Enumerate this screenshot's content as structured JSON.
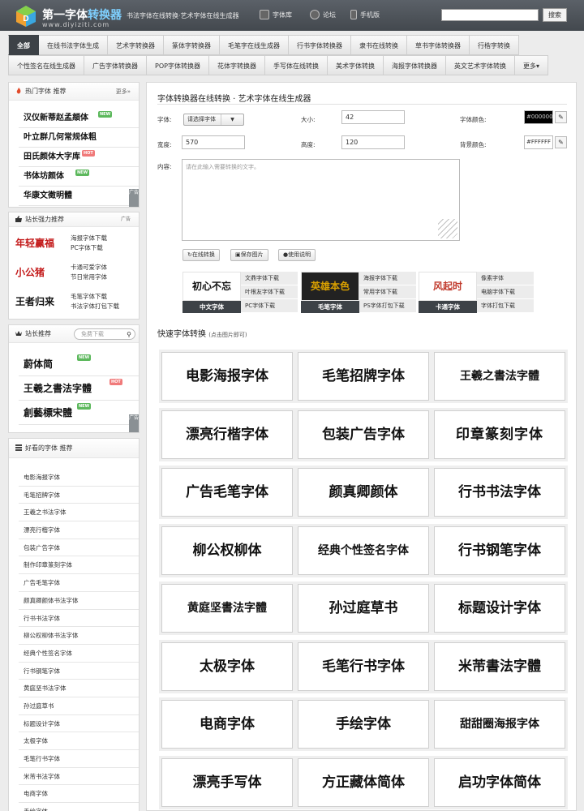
{
  "header": {
    "logo_title_a": "第一字体",
    "logo_title_b": "转换器",
    "logo_sub": "www.diyiziti.com",
    "tagline": "书法字体在线转换·艺术字体在线生成器",
    "links": [
      {
        "label": "字体库",
        "icon": "font-library-icon"
      },
      {
        "label": "论坛",
        "icon": "forum-icon"
      },
      {
        "label": "手机版",
        "icon": "mobile-icon"
      }
    ],
    "search_placeholder": "",
    "search_button": "搜索"
  },
  "nav": {
    "row1": [
      "全部",
      "在线书法字体生成",
      "艺术字转换器",
      "篆体字转换器",
      "毛笔字在线生成器",
      "行书字体转换器",
      "隶书在线转换",
      "草书字体转换器",
      "行楷字转换"
    ],
    "row2": [
      "个性签名在线生成器",
      "广告字体转换器",
      "POP字体转换器",
      "花体字转换器",
      "手写体在线转换",
      "美术字体转换",
      "海报字体转换器",
      "英文艺术字体转换",
      "更多▾"
    ]
  },
  "hot_fonts": {
    "title": "热门字体  推荐",
    "more": "更多»",
    "items": [
      {
        "name": "汉仪新蒂赵孟頫体",
        "badge": "NEW"
      },
      {
        "name": "叶立群几何常规体粗",
        "badge": ""
      },
      {
        "name": "田氏颜体大字库",
        "badge": "HOT"
      },
      {
        "name": "书体坊颜体",
        "badge": "NEW"
      },
      {
        "name": "华康文徵明體",
        "badge": ""
      }
    ],
    "ad": "广告"
  },
  "webmaster_rec": {
    "title": "站长强力推荐",
    "ad": "广告",
    "items": [
      {
        "logo": "年轻赢福",
        "links": [
          "海报字体下载",
          "PC字体下载"
        ]
      },
      {
        "logo": "小公猪",
        "links": [
          "卡通可爱字体",
          "节日常用字体"
        ]
      },
      {
        "logo": "王者归来",
        "links": [
          "毛笔字体下载",
          "书法字体打包下载"
        ]
      }
    ]
  },
  "webmaster_pick": {
    "title": "站长推荐",
    "search_placeholder": "免费下载",
    "items": [
      {
        "name": "蔚体简",
        "badge": "NEW"
      },
      {
        "name": "王羲之書法字體",
        "badge": "HOT"
      },
      {
        "name": "創藝標宋體",
        "badge": "NEW"
      }
    ],
    "ad": "广告"
  },
  "good_fonts": {
    "title": "好看的字体  推荐",
    "items": [
      "电影海报字体",
      "毛笔招牌字体",
      "王羲之书法字体",
      "漂亮行楷字体",
      "包装广告字体",
      "制作印章篆刻字体",
      "广告毛笔字体",
      "颜真卿颜体书法字体",
      "行书书法字体",
      "柳公权柳体书法字体",
      "经典个性签名字体",
      "行书钢笔字体",
      "黄庭坚书法字体",
      "孙过庭草书",
      "标题设计字体",
      "太极字体",
      "毛笔行书字体",
      "米芾书法字体",
      "电商字体",
      "手绘字体"
    ]
  },
  "main": {
    "title": "字体转换器在线转换 · 艺术字体在线生成器",
    "font_label": "字体:",
    "font_select": "请选择字体",
    "size_label": "大小:",
    "size_value": "42",
    "color_label": "字体颜色:",
    "color_value": "#000000",
    "width_label": "宽度:",
    "width_value": "570",
    "height_label": "高度:",
    "height_value": "120",
    "bg_label": "背景颜色:",
    "bg_value": "#FFFFFF",
    "content_label": "内容:",
    "content_placeholder": "请在此输入需要转换的文字。",
    "btn_convert": "在线转换",
    "btn_save": "保存图片",
    "btn_help": "使用说明",
    "quick_title": "快速字体转换",
    "quick_hint": "(点击图片即可)"
  },
  "promos": [
    {
      "img": "初心不忘",
      "label": "中文字体",
      "links": [
        "文鼎字体下载",
        "叶根友字体下载",
        "PC字体下载"
      ]
    },
    {
      "img": "英雄本色",
      "label": "毛笔字体",
      "links": [
        "海报字体下载",
        "常用字体下载",
        "PS字体打包下载"
      ]
    },
    {
      "img": "风起时",
      "label": "卡通字体",
      "links": [
        "像素字体",
        "电脑字体下载",
        "字体打包下载"
      ]
    }
  ],
  "quick_fonts": [
    "电影海报字体",
    "毛笔招牌字体",
    "王羲之書法字體",
    "漂亮行楷字体",
    "包装广告字体",
    "印章篆刻字体",
    "广告毛笔字体",
    "颜真卿颜体",
    "行书书法字体",
    "柳公权柳体",
    "经典个性签名字体",
    "行书钢笔字体",
    "黄庭坚書法字體",
    "孙过庭草书",
    "标题设计字体",
    "太极字体",
    "毛笔行书字体",
    "米芾書法字體",
    "电商字体",
    "手绘字体",
    "甜甜圈海报字体",
    "漂亮手写体",
    "方正藏体简体",
    "启功字体简体"
  ],
  "colors": {
    "accent": "#3d4247",
    "link_hl": "#7fd0ff",
    "new": "#5cb85c",
    "hot": "#f07a7a"
  }
}
